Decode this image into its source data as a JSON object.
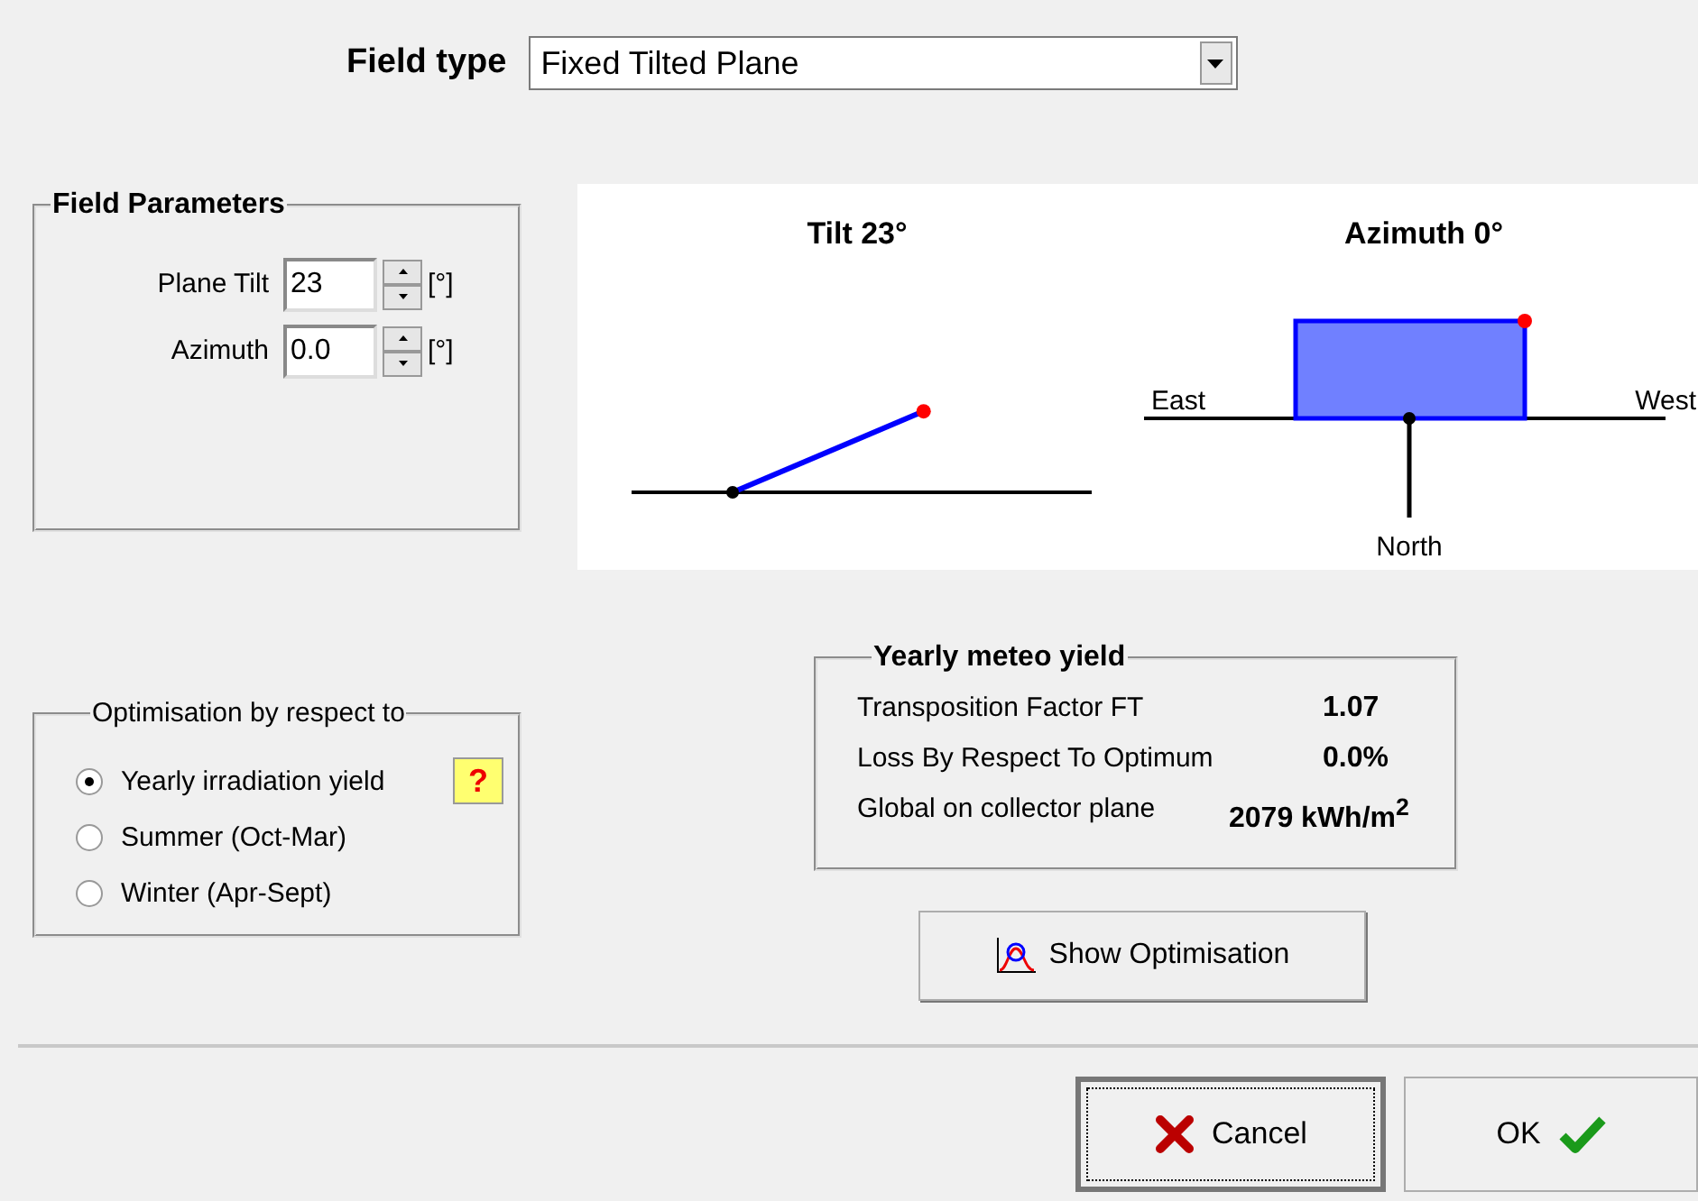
{
  "field_type": {
    "label": "Field type",
    "value": "Fixed Tilted Plane"
  },
  "field_parameters": {
    "title": "Field Parameters",
    "fields": [
      {
        "label": "Plane Tilt",
        "value": "23",
        "unit": "[°]"
      },
      {
        "label": "Azimuth",
        "value": "0.0",
        "unit": "[°]"
      }
    ]
  },
  "diagram": {
    "tilt_title": "Tilt 23°",
    "azimuth_title": "Azimuth 0°",
    "east": "East",
    "west": "West",
    "north": "North"
  },
  "optimisation": {
    "title": "Optimisation by respect to",
    "help": "?",
    "options": [
      {
        "label": "Yearly irradiation yield",
        "selected": true
      },
      {
        "label": "Summer (Oct-Mar)",
        "selected": false
      },
      {
        "label": "Winter (Apr-Sept)",
        "selected": false
      }
    ]
  },
  "yield": {
    "title": "Yearly meteo yield",
    "rows": [
      {
        "label": "Transposition Factor FT",
        "value": "1.07"
      },
      {
        "label": "Loss By Respect To Optimum",
        "value": "0.0%"
      },
      {
        "label": "Global on collector plane",
        "value": "2079 kWh/m$^{2}$"
      }
    ]
  },
  "show_button": "Show Optimisation",
  "buttons": [
    {
      "label": "Cancel",
      "kind": "cancel",
      "focused": true
    },
    {
      "label": "OK",
      "kind": "ok",
      "focused": false
    }
  ]
}
